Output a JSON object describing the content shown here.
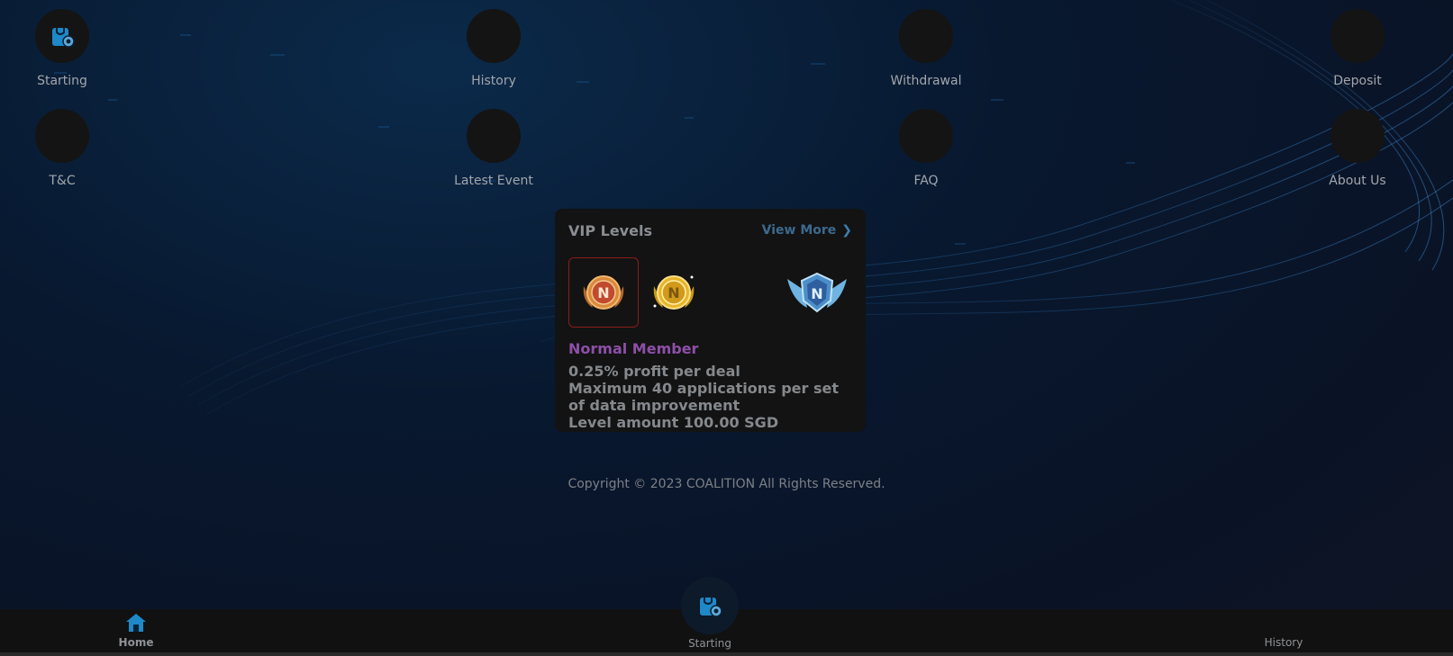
{
  "menu": [
    {
      "label": "Starting",
      "icon": "shopping-bag-icon"
    },
    {
      "label": "History",
      "icon": "history-icon"
    },
    {
      "label": "Withdrawal",
      "icon": "withdrawal-icon"
    },
    {
      "label": "Deposit",
      "icon": "deposit-icon"
    },
    {
      "label": "T&C",
      "icon": "terms-icon"
    },
    {
      "label": "Latest Event",
      "icon": "event-icon"
    },
    {
      "label": "FAQ",
      "icon": "faq-icon"
    },
    {
      "label": "About Us",
      "icon": "about-icon"
    }
  ],
  "vip": {
    "title": "VIP Levels",
    "view_more": "View More",
    "chevron": "❯",
    "badges": [
      {
        "icon": "bronze-n-badge-icon",
        "letter": "N",
        "selected": true
      },
      {
        "icon": "gold-n-badge-icon",
        "letter": "N",
        "selected": false
      },
      {
        "icon": "winged-n-badge-icon",
        "letter": "N",
        "selected": false
      }
    ],
    "member_name": "Normal Member",
    "lines": [
      "0.25% profit per deal",
      "Maximum 40 applications per set",
      "of data improvement",
      "Level amount 100.00 SGD"
    ]
  },
  "copyright": "Copyright © 2023 COALITION All Rights Reserved.",
  "bottom_nav": {
    "home": {
      "label": "Home",
      "icon": "home-icon"
    },
    "starting": {
      "label": "Starting",
      "icon": "shopping-bag-icon"
    },
    "history": {
      "label": "History",
      "icon": "history-icon"
    }
  },
  "colors": {
    "accent_blue": "#1e88c8",
    "member_purple": "#8e4fa8",
    "selected_border": "#8b1c18"
  }
}
